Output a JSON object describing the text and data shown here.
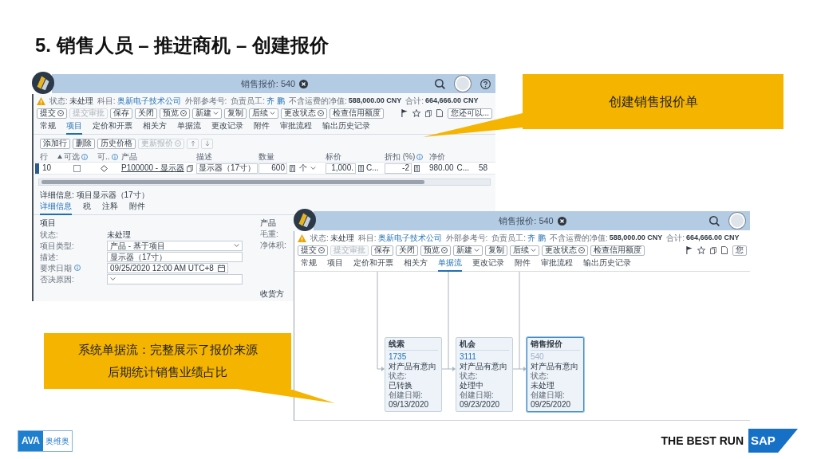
{
  "title": "5. 销售人员 – 推进商机 – 创建报价",
  "item_screen": {
    "header": {
      "title": "销售报价: 540",
      "help_button": true
    },
    "info": [
      {
        "label": "状态:",
        "kind": "text",
        "value": "未处理"
      },
      {
        "label": "科目:",
        "kind": "link",
        "value": "奥新电子技术公司"
      },
      {
        "label": "外部参考号:"
      },
      {
        "label": "负责员工:",
        "kind": "link",
        "value": "齐 鹏"
      },
      {
        "label": "不含运费的净值:",
        "kind": "amount",
        "value": "588,000.00 CNY"
      },
      {
        "label": "合计:",
        "kind": "amount",
        "value": "664,666.00 CNY"
      }
    ],
    "actions": [
      {
        "label": "提交",
        "disabled": false,
        "kind": "dropdown"
      },
      {
        "label": "提交审批",
        "disabled": true,
        "kind": "plain"
      },
      {
        "label": "保存",
        "disabled": false,
        "kind": "plain"
      },
      {
        "label": "关闭",
        "disabled": false,
        "kind": "plain"
      },
      {
        "label": "预览",
        "disabled": false,
        "kind": "dropdown"
      },
      {
        "label": "新建",
        "disabled": false,
        "kind": "submenu"
      },
      {
        "label": "复制",
        "disabled": false,
        "kind": "plain"
      },
      {
        "label": "后续",
        "disabled": false,
        "kind": "submenu"
      },
      {
        "label": "更改状态",
        "disabled": false,
        "kind": "dropdown"
      },
      {
        "label": "检查信用额度",
        "disabled": false,
        "kind": "plain"
      }
    ],
    "more_button": "您还可以...",
    "tabs": [
      {
        "label": "常规",
        "selected": false
      },
      {
        "label": "项目",
        "selected": true
      },
      {
        "label": "定价和开票",
        "selected": false
      },
      {
        "label": "相关方",
        "selected": false
      },
      {
        "label": "单据流",
        "selected": false
      },
      {
        "label": "更改记录",
        "selected": false
      },
      {
        "label": "附件",
        "selected": false
      },
      {
        "label": "审批流程",
        "selected": false
      },
      {
        "label": "输出历史记录",
        "selected": false
      }
    ],
    "item_actions": [
      {
        "label": "添加行",
        "disabled": false,
        "kind": "plain"
      },
      {
        "label": "删除",
        "disabled": false,
        "kind": "plain"
      },
      {
        "label": "历史价格",
        "disabled": false,
        "kind": "plain"
      },
      {
        "label": "更新报价",
        "disabled": true,
        "kind": "dropdown"
      }
    ],
    "table": {
      "columns": [
        {
          "label": "行"
        },
        {
          "label": "可选",
          "sorted": true,
          "info": true
        },
        {
          "label": "可..",
          "info": true
        },
        {
          "label": "产品"
        },
        {
          "label": "描述"
        },
        {
          "label": "数量"
        },
        {
          "label": "标价"
        },
        {
          "label": "折扣 (%)",
          "info": true
        },
        {
          "label": "净价"
        }
      ],
      "rows": [
        {
          "selected": true,
          "line": "10",
          "optional": false,
          "product": "P100000 - 显示器",
          "description": "显示器（17寸）",
          "quantity": "600",
          "unit": "个",
          "list_price": "1,000.",
          "list_currency": "C...",
          "discount": "-2",
          "net_price": "980.00",
          "net_currency": "C...",
          "column_10": "58"
        }
      ]
    },
    "detail": {
      "title": "详细信息: 项目显示器（17寸）",
      "tabs": [
        {
          "label": "详细信息",
          "selected": true
        },
        {
          "label": "税",
          "selected": false
        },
        {
          "label": "注释",
          "selected": false
        },
        {
          "label": "附件",
          "selected": false
        }
      ],
      "section": "项目",
      "fields": [
        {
          "label": "状态:",
          "kind": "text",
          "value": "未处理"
        },
        {
          "label": "项目类型:",
          "kind": "select",
          "value": "产品 - 基于项目"
        },
        {
          "label": "描述:",
          "kind": "input",
          "value": "显示器（17寸）"
        },
        {
          "label": "要求日期",
          "info": true,
          "kind": "date",
          "value": "09/25/2020 12:00 AM UTC+8"
        },
        {
          "label": "否决原因:",
          "kind": "select"
        }
      ],
      "side_section": "产品",
      "side_labels": [
        "毛重:",
        "净体积:"
      ],
      "ship_to": "收货方"
    }
  },
  "flow_screen": {
    "header": {
      "title": "销售报价: 540"
    },
    "info": [
      {
        "label": "状态:",
        "kind": "text",
        "value": "未处理"
      },
      {
        "label": "科目:",
        "kind": "link",
        "value": "奥新电子技术公司"
      },
      {
        "label": "外部参考号:"
      },
      {
        "label": "负责员工:",
        "kind": "link",
        "value": "齐 鹏"
      },
      {
        "label": "不含运费的净值:",
        "kind": "amount",
        "value": "588,000.00 CNY"
      },
      {
        "label": "合计:",
        "kind": "amount",
        "value": "664,666.00 CNY"
      }
    ],
    "actions": [
      {
        "label": "提交",
        "disabled": false,
        "kind": "dropdown"
      },
      {
        "label": "提交审批",
        "disabled": true,
        "kind": "plain"
      },
      {
        "label": "保存",
        "disabled": false,
        "kind": "plain"
      },
      {
        "label": "关闭",
        "disabled": false,
        "kind": "plain"
      },
      {
        "label": "预览",
        "disabled": false,
        "kind": "dropdown"
      },
      {
        "label": "新建",
        "disabled": false,
        "kind": "submenu"
      },
      {
        "label": "复制",
        "disabled": false,
        "kind": "plain"
      },
      {
        "label": "后续",
        "disabled": false,
        "kind": "submenu"
      },
      {
        "label": "更改状态",
        "disabled": false,
        "kind": "dropdown"
      },
      {
        "label": "检查信用额度",
        "disabled": false,
        "kind": "plain"
      }
    ],
    "more_button": "您",
    "tabs": [
      {
        "label": "常规",
        "selected": false
      },
      {
        "label": "项目",
        "selected": false
      },
      {
        "label": "定价和开票",
        "selected": false
      },
      {
        "label": "相关方",
        "selected": false
      },
      {
        "label": "单据流",
        "selected": true
      },
      {
        "label": "更改记录",
        "selected": false
      },
      {
        "label": "附件",
        "selected": false
      },
      {
        "label": "审批流程",
        "selected": false
      },
      {
        "label": "输出历史记录",
        "selected": false
      }
    ],
    "flow_nodes": [
      {
        "type": "线索",
        "id": "1735",
        "current": false,
        "description": "对产品有意向",
        "status_label": "状态:",
        "status": "已转换",
        "date_label": "创建日期:",
        "date": "09/13/2020"
      },
      {
        "type": "机会",
        "id": "3111",
        "current": false,
        "description": "对产品有意向",
        "status_label": "状态:",
        "status": "处理中",
        "date_label": "创建日期:",
        "date": "09/23/2020"
      },
      {
        "type": "销售报价",
        "id": "540",
        "current": true,
        "description": "对产品有意向",
        "status_label": "状态:",
        "status": "未处理",
        "date_label": "创建日期:",
        "date": "09/25/2020"
      }
    ]
  },
  "callouts": [
    {
      "lines": [
        "创建销售报价单"
      ]
    },
    {
      "lines": [
        "系统单据流：完整展示了报价来源",
        "后期统计销售业绩占比"
      ]
    }
  ],
  "footer": {
    "logo_mark": "AVA",
    "logo_name": "奥维奥",
    "tagline": "THE BEST RUN",
    "sap_logo": "SAP"
  }
}
